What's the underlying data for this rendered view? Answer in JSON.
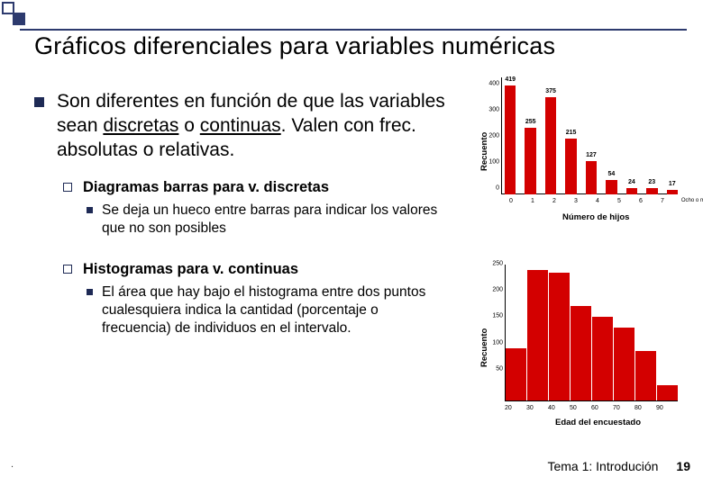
{
  "title": "Gráficos diferenciales para variables numéricas",
  "main_item": {
    "pre": "Son diferentes en función de que las variables sean ",
    "ul1": "discretas",
    "mid": " o ",
    "ul2": "continuas",
    "post": ". Valen con frec. absolutas o relativas."
  },
  "sub1": {
    "heading": "Diagramas barras para v. discretas",
    "body": "Se deja un hueco entre barras para indicar los valores que no son posibles"
  },
  "sub2": {
    "heading": "Histogramas para v. continuas",
    "body": "El área que hay bajo el histograma entre dos puntos cualesquiera indica la cantidad (porcentaje o frecuencia) de individuos en el intervalo."
  },
  "chart1_axis_y": "Recuento",
  "chart1_axis_x": "Número de hijos",
  "chart2_axis_y": "Recuento",
  "chart2_axis_x": "Edad del encuestado",
  "chart_data": [
    {
      "type": "bar",
      "title": "",
      "xlabel": "Número de hijos",
      "ylabel": "Recuento",
      "ylim": [
        0,
        450
      ],
      "categories": [
        "0",
        "1",
        "2",
        "3",
        "4",
        "5",
        "6",
        "7",
        "Ocho o más"
      ],
      "values": [
        419,
        255,
        375,
        215,
        127,
        54,
        24,
        23,
        17
      ],
      "yticks": [
        0,
        100,
        200,
        300,
        400
      ]
    },
    {
      "type": "bar",
      "title": "",
      "xlabel": "Edad del encuestado",
      "ylabel": "Recuento",
      "ylim": [
        0,
        260
      ],
      "categories": [
        "20",
        "30",
        "40",
        "50",
        "60",
        "70",
        "80",
        "90"
      ],
      "values": [
        100,
        250,
        245,
        180,
        160,
        140,
        95,
        30
      ],
      "yticks": [
        50,
        100,
        150,
        200,
        250
      ]
    }
  ],
  "footer_text": "Tema 1: Introdución",
  "page_number": "19"
}
